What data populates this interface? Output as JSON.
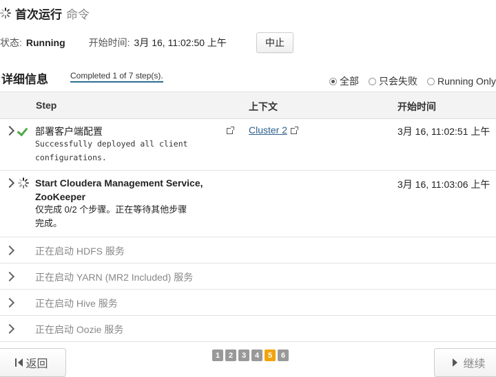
{
  "header": {
    "title": "首次运行",
    "subtitle": "命令"
  },
  "status": {
    "label": "状态:",
    "value": "Running",
    "start_label": "开始时间:",
    "start_value": "3月 16, 11:02:50 上午",
    "abort_label": "中止"
  },
  "details": {
    "title": "详细信息",
    "completed_text": "Completed 1 of 7 step(s).",
    "filters": [
      {
        "label": "全部",
        "selected": true
      },
      {
        "label": "只会失败",
        "selected": false
      },
      {
        "label": "Running Only",
        "selected": false
      }
    ]
  },
  "table": {
    "columns": [
      "Step",
      "上下文",
      "开始时间"
    ],
    "rows": [
      {
        "name": "部署客户端配置",
        "detail_line1": "Successfully deployed all client",
        "detail_line2": "configurations.",
        "context": "Cluster 2",
        "time": "3月 16, 11:02:51 上午",
        "status": "success"
      },
      {
        "name_line1": "Start Cloudera Management Service,",
        "name_line2": "ZooKeeper",
        "detail_line1": "仅完成 0/2 个步骤。正在等待其他步骤",
        "detail_line2": "完成。",
        "time": "3月 16, 11:03:06 上午",
        "status": "running"
      },
      {
        "name": "正在启动 HDFS 服务",
        "status": "pending"
      },
      {
        "name": "正在启动 YARN (MR2 Included) 服务",
        "status": "pending"
      },
      {
        "name": "正在启动 Hive 服务",
        "status": "pending"
      },
      {
        "name": "正在启动 Oozie 服务",
        "status": "pending"
      }
    ]
  },
  "footer": {
    "back_label": "返回",
    "next_label": "继续",
    "pages": [
      "1",
      "2",
      "3",
      "4",
      "5",
      "6"
    ],
    "active_page": "5"
  },
  "colors": {
    "accent": "#f0a40c",
    "success": "#4ca845",
    "link": "#2b5f8c"
  }
}
